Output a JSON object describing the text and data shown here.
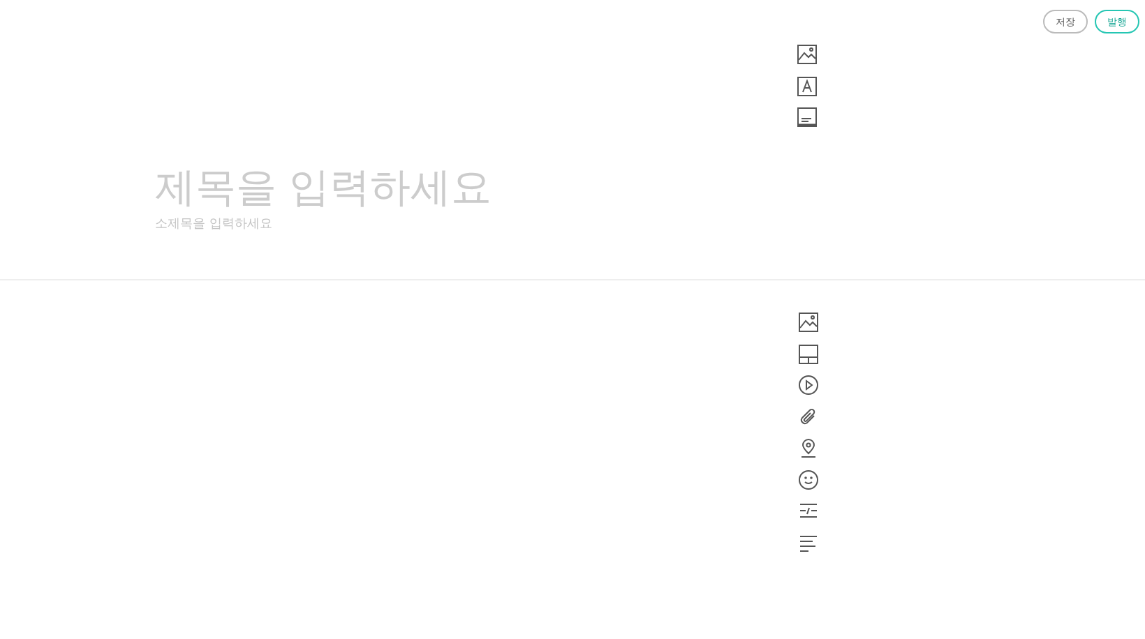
{
  "header_buttons": [
    {
      "label": "저장",
      "kind": "plain"
    },
    {
      "label": "발행",
      "kind": "primary"
    }
  ],
  "title_field": {
    "placeholder": "제목을 입력하세요"
  },
  "subtitle_field": {
    "placeholder": "소제목을 입력하세요"
  }
}
